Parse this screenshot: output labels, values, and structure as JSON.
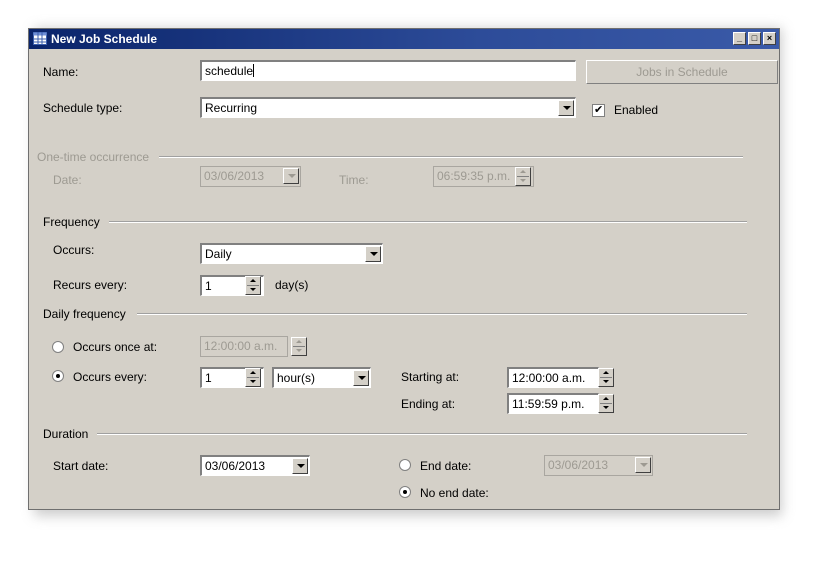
{
  "window": {
    "title": "New Job Schedule",
    "controls": {
      "minimize": "_",
      "maximize": "□",
      "close": "×"
    }
  },
  "name": {
    "label": "Name:",
    "value": "schedule"
  },
  "jobs_button": {
    "label": "Jobs in Schedule"
  },
  "schedule_type": {
    "label": "Schedule type:",
    "value": "Recurring"
  },
  "enabled": {
    "label": "Enabled",
    "checked": true,
    "check_glyph": "✔"
  },
  "one_time": {
    "group_label": "One-time occurrence",
    "date_label": "Date:",
    "date_value": "03/06/2013",
    "time_label": "Time:",
    "time_value": "06:59:35 p.m."
  },
  "frequency": {
    "group_label": "Frequency",
    "occurs_label": "Occurs:",
    "occurs_value": "Daily",
    "recurs_label": "Recurs every:",
    "recurs_value": "1",
    "recurs_unit": "day(s)"
  },
  "daily_frequency": {
    "group_label": "Daily frequency",
    "once_label": "Occurs once at:",
    "once_value": "12:00:00 a.m.",
    "every_label": "Occurs every:",
    "every_value": "1",
    "every_unit": "hour(s)",
    "starting_label": "Starting at:",
    "starting_value": "12:00:00 a.m.",
    "ending_label": "Ending at:",
    "ending_value": "11:59:59 p.m."
  },
  "duration": {
    "group_label": "Duration",
    "start_label": "Start date:",
    "start_value": "03/06/2013",
    "end_label": "End date:",
    "end_value": "03/06/2013",
    "no_end_label": "No end date:"
  },
  "colors": {
    "titlebar": "#0a246a",
    "dialog": "#d4d0c8",
    "disabled_text": "#9d9a92"
  }
}
